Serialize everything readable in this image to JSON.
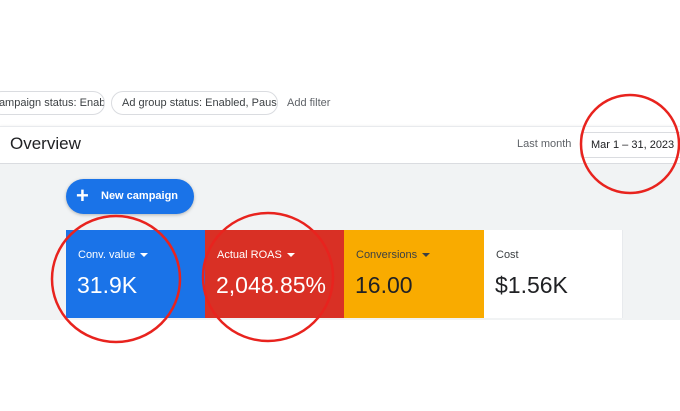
{
  "filters": {
    "campaign_status": "Campaign status: Enabled",
    "ad_group_status": "Ad group status: Enabled, Paused",
    "add_filter": "Add filter"
  },
  "overview": {
    "title": "Overview",
    "date_label": "Last month",
    "date_range": "Mar 1 – 31, 2023"
  },
  "actions": {
    "new_campaign_label": "New campaign"
  },
  "metrics": [
    {
      "label": "Conv. value",
      "value": "31.9K",
      "color": "#1a73e8"
    },
    {
      "label": "Actual ROAS",
      "value": "2,048.85%",
      "color": "#d93025"
    },
    {
      "label": "Conversions",
      "value": "16.00",
      "color": "#f9ab00"
    },
    {
      "label": "Cost",
      "value": "$1.56K",
      "color": "#ffffff"
    }
  ],
  "annotations": {
    "color": "#e8231e",
    "circled": [
      "date-range",
      "conv-value",
      "actual-roas"
    ]
  }
}
